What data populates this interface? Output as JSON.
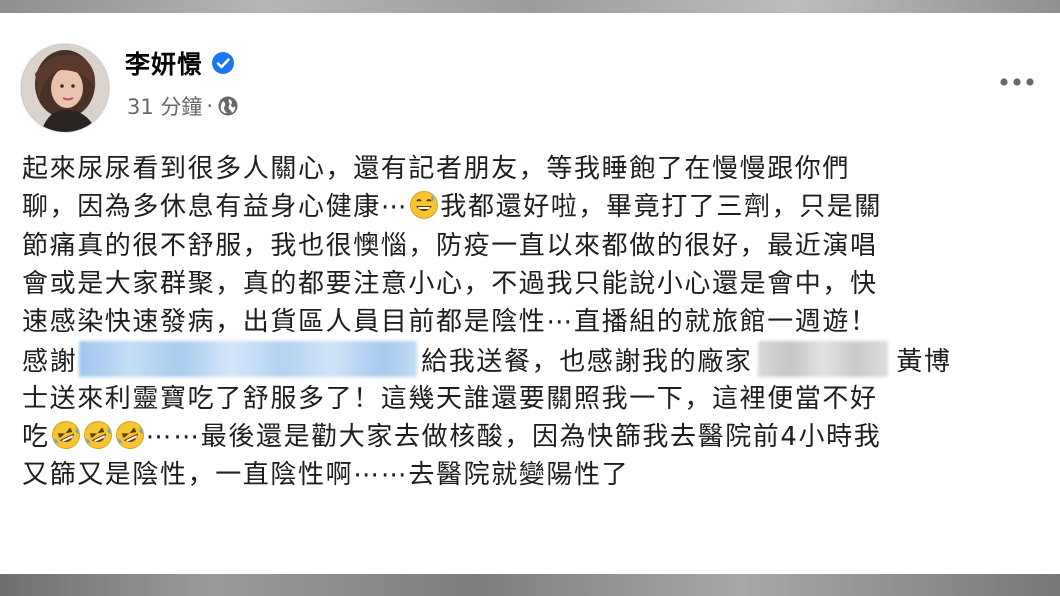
{
  "post": {
    "author_name": "李妍憬",
    "timestamp": "31 分鐘",
    "separator": "·",
    "privacy": "globe-icon",
    "verified": "verified-badge-icon",
    "more_options": "more-options-icon",
    "accent_color": "#1877f2",
    "text_color": "#1c1e21",
    "meta_color": "#65676b",
    "body": {
      "line1": "起來尿尿看到很多人關心，還有記者朋友，等我睡飽了在慢慢跟你們",
      "line2a": "聊，因為多休息有益身心健康⋯",
      "line2b": "我都還好啦，畢竟打了三劑，只是關",
      "line3": "節痛真的很不舒服，我也很懊惱，防疫一直以來都做的很好，最近演唱",
      "line4": "會或是大家群聚，真的都要注意小心，不過我只能說小心還是會中，快",
      "line5": "速感染快速發病，出貨區人員目前都是陰性⋯直播組的就旅館一週遊！",
      "line6a": "感謝",
      "line6b": "給我送餐，也感謝我的廠家",
      "line6c": "黃博",
      "line7": "士送來利靈寶吃了舒服多了！這幾天誰還要關照我一下，這裡便當不好",
      "line8a": "吃",
      "line8b": "⋯⋯最後還是勸大家去做核酸，因為快篩我去醫院前4小時我",
      "line9": "又篩又是陰性，一直陰性啊⋯⋯去醫院就變陽性了"
    },
    "emojis": {
      "sweat_smile": "grinning-sweat-emoji",
      "tears_of_joy": "rolling-laughing-emoji"
    },
    "redactions": [
      "blurred-name-1",
      "blurred-name-2"
    ]
  }
}
